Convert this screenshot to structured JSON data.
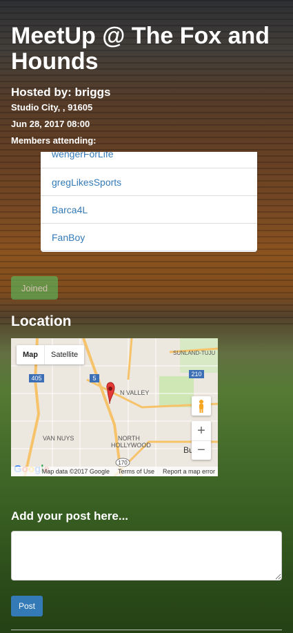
{
  "event": {
    "title": "MeetUp @ The Fox and Hounds",
    "host_text": "Hosted by: briggs",
    "address": "Studio City, , 91605",
    "datetime": "Jun 28, 2017 08:00",
    "members_label": "Members attending:"
  },
  "members": [
    "wengerForLife",
    "gregLikesSports",
    "Barca4L",
    "FanBoy"
  ],
  "joined_button": "Joined",
  "location": {
    "heading": "Location",
    "map": {
      "type_map": "Map",
      "type_satellite": "Satellite",
      "labels": {
        "sunland": "SUNLAND-TUJU",
        "valley": "N VALLEY",
        "van_nuys": "VAN NUYS",
        "north_hollywood": "NORTH\nHOLLYWOOD",
        "burbank": "Bu     nk",
        "i405": "405",
        "i5": "5",
        "r210": "210",
        "r170": "170"
      },
      "zoom_in": "+",
      "zoom_out": "−",
      "google": "Google",
      "footer": {
        "data": "Map data ©2017 Google",
        "terms": "Terms of Use",
        "report": "Report a map error"
      }
    }
  },
  "post": {
    "heading": "Add your post here...",
    "placeholder": "",
    "button": "Post"
  },
  "colors": {
    "link": "#337ab7",
    "joined": "#5cb85c",
    "post_button": "#337ab7",
    "marker": "#e53935"
  }
}
